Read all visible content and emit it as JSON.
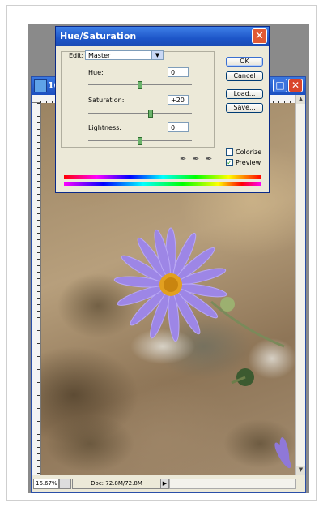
{
  "document": {
    "title": "10",
    "zoom": "16.67%",
    "doc_info": "Doc: 72.8M/72.8M"
  },
  "dialog": {
    "title": "Hue/Saturation",
    "edit_label": "Edit:",
    "edit_value": "Master",
    "hue_label": "Hue:",
    "hue_value": "0",
    "saturation_label": "Saturation:",
    "saturation_value": "+20",
    "lightness_label": "Lightness:",
    "lightness_value": "0",
    "ok_label": "OK",
    "cancel_label": "Cancel",
    "load_label": "Load...",
    "save_label": "Save...",
    "colorize_label": "Colorize",
    "colorize_checked": false,
    "preview_label": "Preview",
    "preview_checked": true
  }
}
